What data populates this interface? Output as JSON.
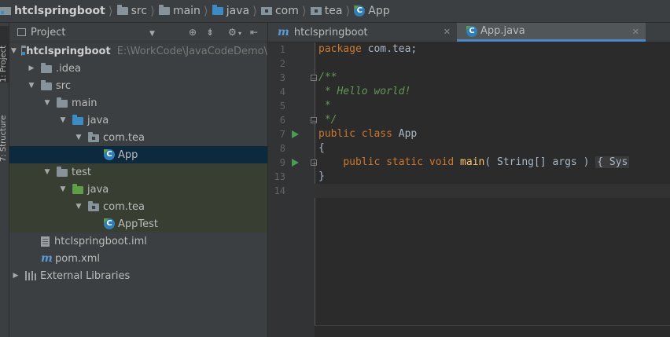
{
  "navbar": {
    "crumbs": [
      "htclspringboot",
      "src",
      "main",
      "java",
      "com",
      "tea",
      "App"
    ]
  },
  "left_strip": {
    "tabs": [
      "1: Project",
      "7: Structure"
    ]
  },
  "project_panel": {
    "title": "Project",
    "view_dropdown_icon": "chevron-down-icon",
    "toolbar_icons": [
      "locate-icon",
      "collapse-all-icon",
      "gear-icon",
      "hide-icon"
    ],
    "tree": [
      {
        "label": "htclspringboot",
        "path": "E:\\WorkCode\\JavaCodeDemo\\",
        "depth": 0,
        "expanded": true,
        "icon": "module-folder-icon"
      },
      {
        "label": ".idea",
        "depth": 1,
        "expanded": false,
        "icon": "folder-icon"
      },
      {
        "label": "src",
        "depth": 1,
        "expanded": true,
        "icon": "folder-icon"
      },
      {
        "label": "main",
        "depth": 2,
        "expanded": true,
        "icon": "folder-icon"
      },
      {
        "label": "java",
        "depth": 3,
        "expanded": true,
        "icon": "source-root-icon"
      },
      {
        "label": "com.tea",
        "depth": 4,
        "expanded": true,
        "icon": "package-icon"
      },
      {
        "label": "App",
        "depth": 5,
        "icon": "java-class-icon",
        "selected": true
      },
      {
        "label": "test",
        "depth": 2,
        "expanded": true,
        "icon": "folder-icon"
      },
      {
        "label": "java",
        "depth": 3,
        "expanded": true,
        "icon": "test-root-icon"
      },
      {
        "label": "com.tea",
        "depth": 4,
        "expanded": true,
        "icon": "package-icon"
      },
      {
        "label": "AppTest",
        "depth": 5,
        "icon": "java-class-icon"
      },
      {
        "label": "htclspringboot.iml",
        "depth": 1,
        "icon": "iml-file-icon"
      },
      {
        "label": "pom.xml",
        "depth": 1,
        "icon": "maven-icon"
      },
      {
        "label": "External Libraries",
        "depth": 0,
        "expanded": false,
        "icon": "libraries-icon"
      }
    ]
  },
  "editor": {
    "tabs": [
      {
        "label": "htclspringboot",
        "icon": "maven-icon",
        "active": false
      },
      {
        "label": "App.java",
        "icon": "java-class-icon",
        "active": true
      }
    ],
    "line_numbers": [
      "1",
      "2",
      "3",
      "4",
      "5",
      "6",
      "7",
      "8",
      "9",
      "13",
      "14"
    ],
    "code": {
      "l1_kw": "package",
      "l1_rest": " com.tea;",
      "l3": "/**",
      "l4": " * Hello world!",
      "l5": " *",
      "l6": " */",
      "l7_kw1": "public",
      "l7_kw2": "class",
      "l7_name": "App",
      "l8": "{",
      "l9_indent": "    ",
      "l9_kw1": "public",
      "l9_kw2": "static",
      "l9_kw3": "void",
      "l9_fn": "main",
      "l9_params": "( String[] args ) ",
      "l9_folded": "{ Sys",
      "l13": "}"
    }
  }
}
